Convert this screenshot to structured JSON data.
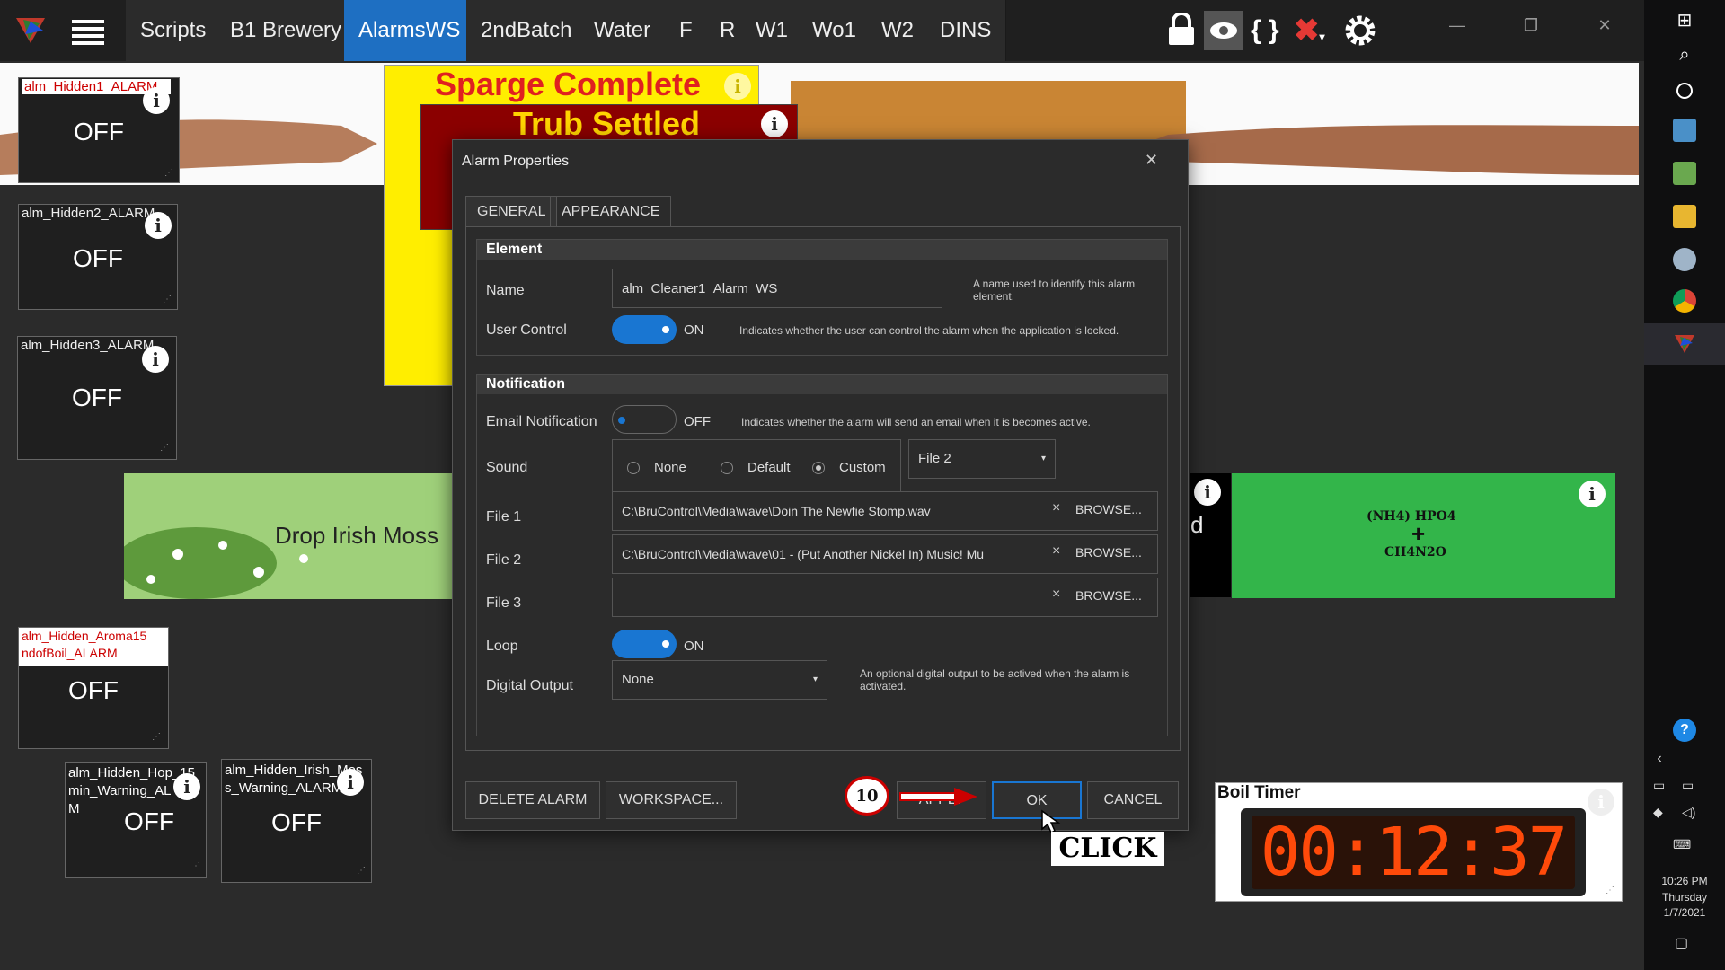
{
  "topbar": {
    "tabs": [
      "Scripts",
      "B1 Brewery",
      "AlarmsWS",
      "2ndBatch",
      "Water",
      "F",
      "R",
      "W1",
      "Wo1",
      "W2",
      "DINS"
    ],
    "active_tab": "AlarmsWS",
    "icons": [
      "lock-icon",
      "eye-icon",
      "braces-icon",
      "close-x-icon",
      "gear-icon"
    ],
    "window_controls": {
      "minimize": "—",
      "restore": "❐",
      "close": "✕"
    }
  },
  "widgets": {
    "w1": {
      "name": "alm_Hidden1_ALARM",
      "value": "OFF"
    },
    "w2": {
      "name": "alm_Hidden2_ALARM",
      "value": "OFF"
    },
    "w3": {
      "name": "alm_Hidden3_ALARM",
      "value": "OFF"
    },
    "w4": {
      "name_line1": "alm_Hidden_Aroma15",
      "name_line2": "ndofBoil_ALARM",
      "value": "OFF"
    },
    "w5": {
      "name_line1": "alm_Hidden_Hop_15",
      "name_line2": "min_Warning_AL",
      "name_line3": "M",
      "value": "OFF"
    },
    "w6": {
      "name_line1": "alm_Hidden_Irish_Mos",
      "name_line2": "s_Warning_ALARM",
      "value": "OFF"
    }
  },
  "banners": {
    "sparge": "Sparge Complete",
    "trub": "Trub Settled",
    "irish_moss": "Drop Irish Moss",
    "chem_line1": "(NH4) HPO4",
    "chem_line2": "+",
    "chem_line3": "CH4N2O"
  },
  "boil_timer": {
    "title": "Boil Timer",
    "digits": "00:12:37",
    "color": "#ff4a0a"
  },
  "dialog": {
    "title": "Alarm Properties",
    "tabs": [
      "GENERAL",
      "APPEARANCE"
    ],
    "element_section": "Element",
    "name_label": "Name",
    "name_value": "alm_Cleaner1_Alarm_WS",
    "name_desc": "A name used to identify this alarm element.",
    "user_control_label": "User Control",
    "user_control_state": "ON",
    "user_control_desc": "Indicates whether the user can control the alarm when the application is locked.",
    "notification_section": "Notification",
    "email_label": "Email Notification",
    "email_state": "OFF",
    "email_desc": "Indicates whether the alarm will send an email when it is becomes active.",
    "sound_label": "Sound",
    "sound_options": [
      "None",
      "Default",
      "Custom"
    ],
    "sound_selected": "Custom",
    "sound_file_select": "File 2",
    "file1_label": "File 1",
    "file1_value": "C:\\BruControl\\Media\\wave\\Doin The Newfie Stomp.wav",
    "file2_label": "File 2",
    "file2_value": "C:\\BruControl\\Media\\wave\\01 - (Put Another Nickel In) Music! Mu",
    "file3_label": "File 3",
    "file3_value": "",
    "browse_label": "BROWSE...",
    "clear_glyph": "×",
    "loop_label": "Loop",
    "loop_state": "ON",
    "digital_output_label": "Digital Output",
    "digital_output_value": "None",
    "digital_output_desc": "An optional digital output to be actived when the alarm is activated.",
    "buttons": {
      "delete": "DELETE ALARM",
      "workspace": "WORKSPACE...",
      "apply": "APPLY",
      "ok": "OK",
      "cancel": "CANCEL"
    },
    "close_glyph": "✕"
  },
  "annotation": {
    "step": "10",
    "click_label": "CLICK"
  },
  "clock": {
    "time": "10:26 PM",
    "day": "Thursday",
    "date": "1/7/2021"
  }
}
